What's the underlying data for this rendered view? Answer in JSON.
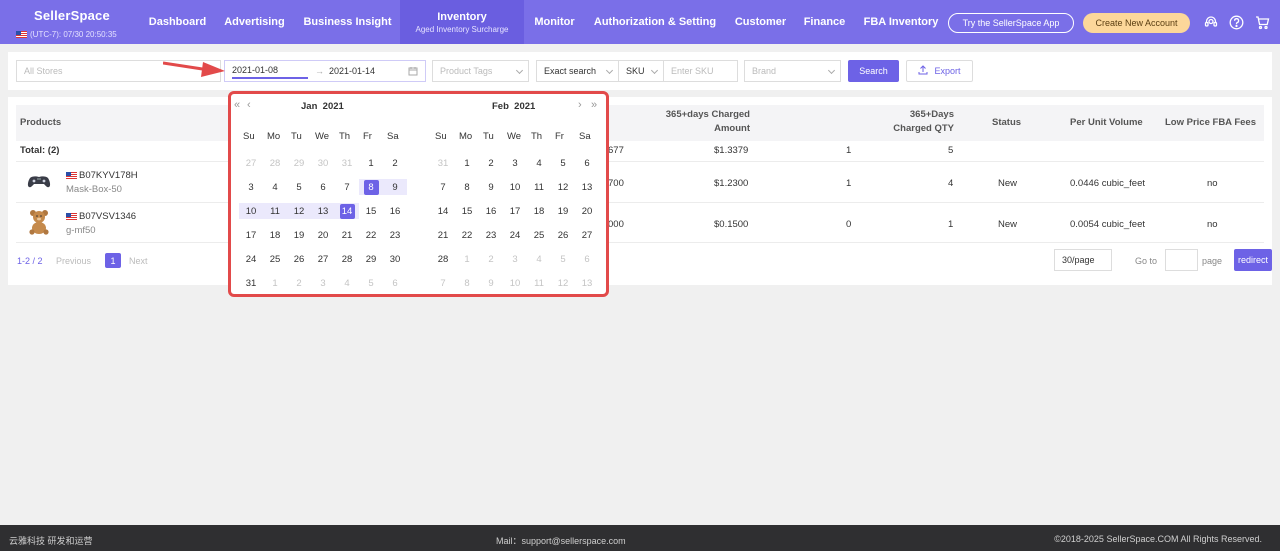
{
  "header": {
    "logo": "SellerSpace",
    "timezone": "(UTC-7): 07/30 20:50:35",
    "nav": [
      {
        "label": "Dashboard"
      },
      {
        "label": "Advertising"
      },
      {
        "label": "Business Insight"
      },
      {
        "label": "Inventory",
        "sub": "Aged Inventory Surcharge",
        "active": true
      },
      {
        "label": "Monitor"
      },
      {
        "label": "Authorization & Setting"
      },
      {
        "label": "Customer"
      },
      {
        "label": "Finance"
      },
      {
        "label": "FBA Inventory"
      }
    ],
    "try_app": "Try the SellerSpace App",
    "create_account": "Create New Account",
    "icons": [
      "support-icon",
      "help-icon",
      "cart-icon"
    ]
  },
  "filters": {
    "stores_placeholder": "All Stores",
    "date_start": "2021-01-08",
    "date_end": "2021-01-14",
    "tags_placeholder": "Product Tags",
    "search_mode": "Exact search",
    "sku_type": "SKU",
    "sku_placeholder": "Enter SKU",
    "brand_placeholder": "Brand",
    "search_label": "Search",
    "export_label": "Export"
  },
  "table": {
    "headers": {
      "products": "Products",
      "charged_amount_line1": "365+days Charged",
      "charged_amount_line2": "Amount",
      "charged_qty_line1": "365+Days",
      "charged_qty_line2": "Charged QTY",
      "status": "Status",
      "unit_volume": "Per Unit Volume",
      "low_price": "Low Price FBA Fees"
    },
    "total": {
      "label": "Total: (2)",
      "partial": "677",
      "amount": "$1.3379",
      "col_a": "1",
      "qty": "5"
    },
    "rows": [
      {
        "asin": "B07KYV178H",
        "sku": "Mask-Box-50",
        "partial": "700",
        "amount": "$1.2300",
        "col_a": "1",
        "qty": "4",
        "status": "New",
        "volume": "0.0446 cubic_feet",
        "low_price": "no",
        "thumb": "game-controller"
      },
      {
        "asin": "B07VSV1346",
        "sku": "g-mf50",
        "partial": "000",
        "amount": "$0.1500",
        "col_a": "0",
        "qty": "1",
        "status": "New",
        "volume": "0.0054 cubic_feet",
        "low_price": "no",
        "thumb": "teddy-bear"
      }
    ]
  },
  "pagination": {
    "range": "1-2 / 2",
    "previous": "Previous",
    "current": "1",
    "next": "Next",
    "per_page": "30/page",
    "goto": "Go to",
    "page_label": "page",
    "redirect": "redirect"
  },
  "datepicker": {
    "weekdays": [
      "Su",
      "Mo",
      "Tu",
      "We",
      "Th",
      "Fr",
      "Sa"
    ],
    "left": {
      "month": "Jan",
      "year": "2021",
      "days": [
        27,
        28,
        29,
        30,
        31,
        1,
        2,
        3,
        4,
        5,
        6,
        7,
        8,
        9,
        10,
        11,
        12,
        13,
        14,
        15,
        16,
        17,
        18,
        19,
        20,
        21,
        22,
        23,
        24,
        25,
        26,
        27,
        28,
        29,
        30,
        31,
        1,
        2,
        3,
        4,
        5,
        6
      ],
      "first_in_month": 5,
      "count_in_month": 31,
      "selected_start": 8,
      "selected_end": 14
    },
    "right": {
      "month": "Feb",
      "year": "2021",
      "days": [
        31,
        1,
        2,
        3,
        4,
        5,
        6,
        7,
        8,
        9,
        10,
        11,
        12,
        13,
        14,
        15,
        16,
        17,
        18,
        19,
        20,
        21,
        22,
        23,
        24,
        25,
        26,
        27,
        28,
        1,
        2,
        3,
        4,
        5,
        6,
        7,
        8,
        9,
        10,
        11,
        12,
        13
      ],
      "first_in_month": 1,
      "count_in_month": 28
    }
  },
  "footer": {
    "left": "云雅科技 研发和运营",
    "mail": "Mail：support@sellerspace.com",
    "copyright": "©2018-2025 SellerSpace.COM All Rights Reserved."
  },
  "colors": {
    "primary": "#7a6fe8",
    "accent": "#6d62e6",
    "highlight_border": "#e24a4a",
    "button_yellow": "#fcd79a"
  }
}
